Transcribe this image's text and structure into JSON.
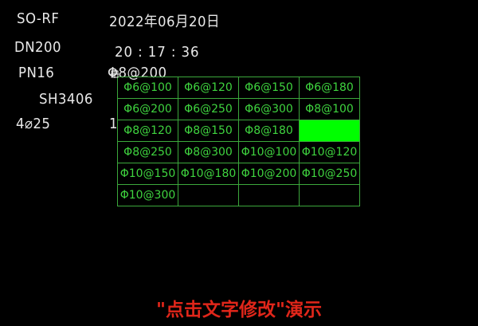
{
  "drawing": {
    "flange_type": "SO-RF",
    "nominal_diameter": "DN200",
    "nominal_pressure": "PN16",
    "standard": "SH3406",
    "bolt_spec": "4⌀25",
    "bolt_qty": "1",
    "date": "2022年06月20日",
    "time": "20 : 17 : 36",
    "rebar_value": "Φ8@200"
  },
  "picker": {
    "rows": [
      [
        "Φ6@100",
        "Φ6@120",
        "Φ6@150",
        "Φ6@180"
      ],
      [
        "Φ6@200",
        "Φ6@250",
        "Φ6@300",
        "Φ8@100"
      ],
      [
        "Φ8@120",
        "Φ8@150",
        "Φ8@180",
        ""
      ],
      [
        "Φ8@250",
        "Φ8@300",
        "Φ10@100",
        "Φ10@120"
      ],
      [
        "Φ10@150",
        "Φ10@180",
        "Φ10@200",
        "Φ10@250"
      ],
      [
        "Φ10@300",
        "",
        "",
        ""
      ]
    ],
    "selected": {
      "row": 2,
      "col": 3
    },
    "line_color": "#3ca83c",
    "text_color": "#3fd43f",
    "highlight_color": "#00ff00"
  },
  "caption": "\"点击文字修改\"演示",
  "caption_color": "#e0261a",
  "background_color": "#000000"
}
